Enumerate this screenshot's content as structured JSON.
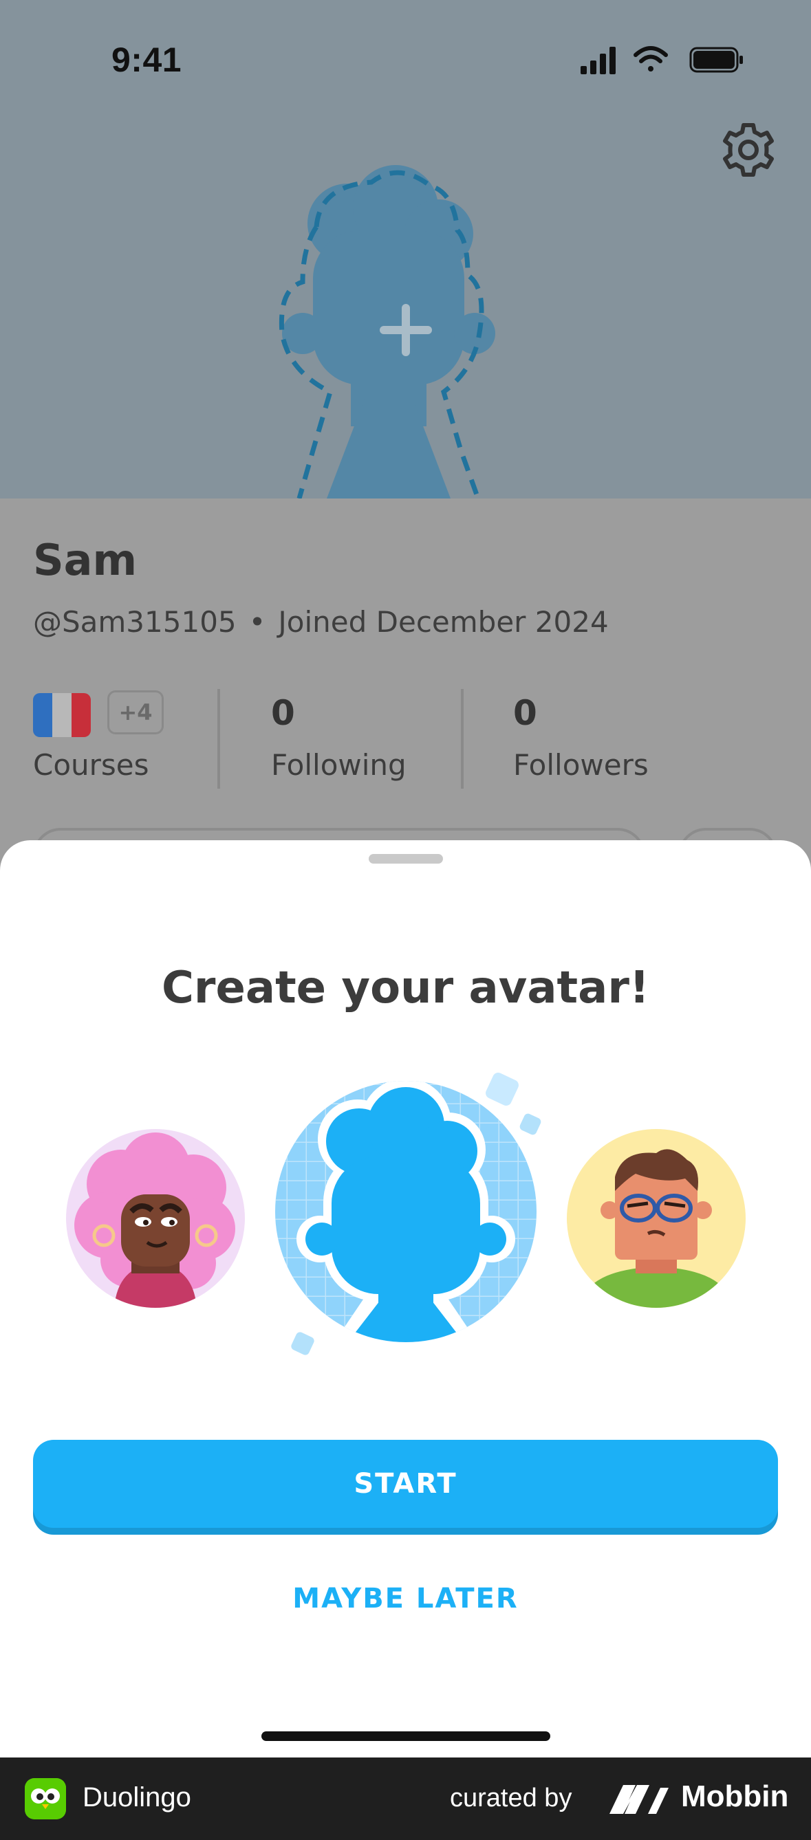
{
  "status_bar": {
    "time": "9:41"
  },
  "profile": {
    "name": "Sam",
    "username": "@Sam315105",
    "separator": "•",
    "joined": "Joined December 2024",
    "courses": {
      "extra_badge": "+4",
      "label": "Courses",
      "flag": "france-flag-icon"
    },
    "following": {
      "value": "0",
      "label": "Following"
    },
    "followers": {
      "value": "0",
      "label": "Followers"
    }
  },
  "sheet": {
    "title": "Create your avatar!",
    "start_label": "START",
    "later_label": "MAYBE LATER"
  },
  "footer": {
    "app_name": "Duolingo",
    "curated_by": "curated by",
    "brand": "Mobbin"
  },
  "colors": {
    "primary": "#1cb0f6",
    "primary_shadow": "#1899d6",
    "header_dim": "#85939c",
    "profile_dim": "#9d9d9d"
  }
}
